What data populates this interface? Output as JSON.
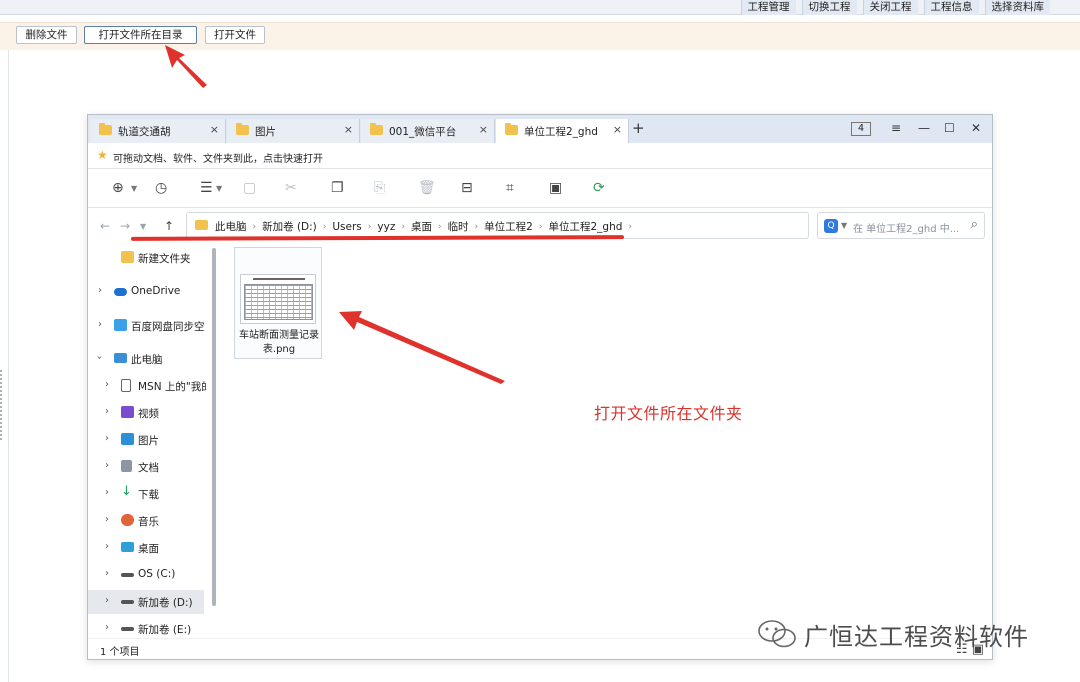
{
  "app": {
    "top_menu": [
      "工程管理",
      "切换工程",
      "关闭工程",
      "工程信息",
      "选择资料库"
    ],
    "toolbar": {
      "delete_label": "删除文件",
      "open_dir_label": "打开文件所在目录",
      "open_file_label": "打开文件"
    }
  },
  "explorer": {
    "tabs": [
      {
        "label": "轨道交通胡",
        "active": false
      },
      {
        "label": "图片",
        "active": false
      },
      {
        "label": "001_微信平台",
        "active": false
      },
      {
        "label": "单位工程2_ghd",
        "active": true
      }
    ],
    "tab_count": "4",
    "new_tab_symbol": "+",
    "close_symbol": "×",
    "window_controls": {
      "menu": "≡",
      "minimize": "—",
      "maximize": "☐",
      "close": "✕"
    },
    "tip": "可拖动文档、软件、文件夹到此，点击快速打开",
    "address": {
      "crumbs": [
        "此电脑",
        "新加卷 (D:)",
        "Users",
        "yyz",
        "桌面",
        "临时",
        "单位工程2",
        "单位工程2_ghd"
      ]
    },
    "search": {
      "placeholder": "在 单位工程2_ghd 中..."
    },
    "sidebar": [
      {
        "label": "新建文件夹",
        "icon": "folder-icon",
        "color": "#f3c24e"
      },
      {
        "label": "OneDrive",
        "icon": "cloud-icon",
        "color": "#1d6fd1"
      },
      {
        "label": "百度网盘同步空间",
        "icon": "baidu-disk-icon",
        "color": "#3aa0e8"
      },
      {
        "label": "此电脑",
        "icon": "computer-icon",
        "color": "#3b8fd6"
      },
      {
        "label": "MSN 上的\"我的",
        "icon": "document-icon",
        "color": "#ffffff"
      },
      {
        "label": "视频",
        "icon": "video-icon",
        "color": "#7b4bd0"
      },
      {
        "label": "图片",
        "icon": "picture-icon",
        "color": "#2d8fd8"
      },
      {
        "label": "文档",
        "icon": "document-icon",
        "color": "#8c97a3"
      },
      {
        "label": "下载",
        "icon": "download-icon",
        "color": "#1aa260"
      },
      {
        "label": "音乐",
        "icon": "music-icon",
        "color": "#e4643a"
      },
      {
        "label": "桌面",
        "icon": "desktop-icon",
        "color": "#2f9fd8"
      },
      {
        "label": "OS (C:)",
        "icon": "drive-icon",
        "color": "#555555"
      },
      {
        "label": "新加卷 (D:)",
        "icon": "drive-icon",
        "color": "#555555"
      },
      {
        "label": "新加卷 (E:)",
        "icon": "drive-icon",
        "color": "#555555"
      }
    ],
    "file": {
      "name": "车站断面测量记录表.png"
    },
    "status": "1 个项目"
  },
  "annotation": {
    "label": "打开文件所在文件夹",
    "color": "#d8332b"
  },
  "watermark": {
    "text": "广恒达工程资料软件"
  }
}
